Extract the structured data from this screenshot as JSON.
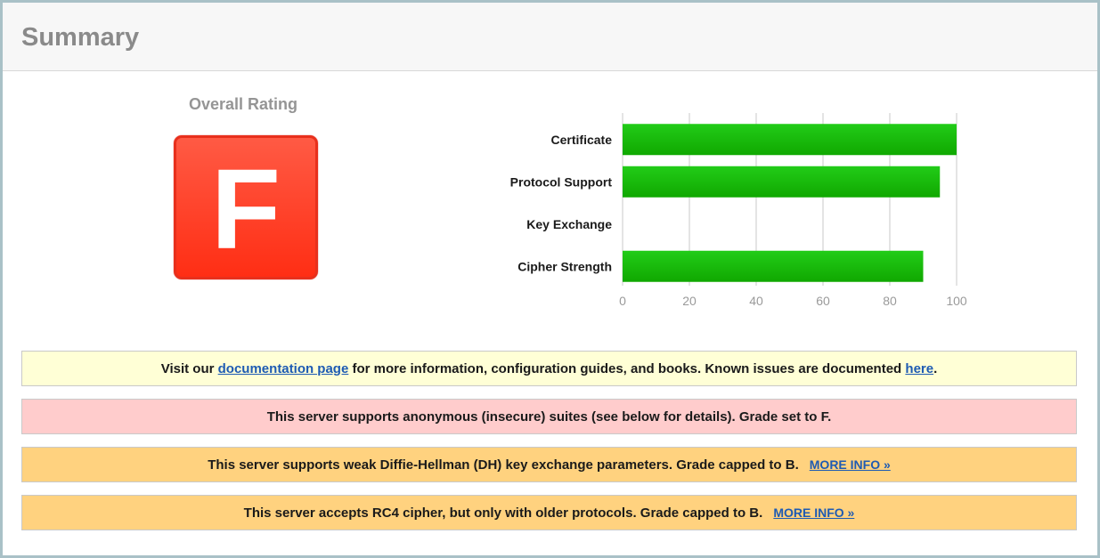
{
  "header": {
    "title": "Summary"
  },
  "rating": {
    "label": "Overall Rating",
    "grade": "F"
  },
  "chart_data": {
    "type": "bar",
    "orientation": "horizontal",
    "categories": [
      "Certificate",
      "Protocol Support",
      "Key Exchange",
      "Cipher Strength"
    ],
    "values": [
      100,
      95,
      0,
      90
    ],
    "xlim": [
      0,
      100
    ],
    "xticks": [
      0,
      20,
      40,
      60,
      80,
      100
    ],
    "grid": true,
    "bar_color": "#19b800"
  },
  "notices": {
    "docs": {
      "prefix": "Visit our ",
      "link1": "documentation page",
      "middle": " for more information, configuration guides, and books. Known issues are documented ",
      "link2": "here",
      "suffix": "."
    },
    "anon": {
      "text": "This server supports anonymous (insecure) suites (see below for details). Grade set to F."
    },
    "dh": {
      "text": "This server supports weak Diffie-Hellman (DH) key exchange parameters. Grade capped to B.",
      "link": "MORE INFO »"
    },
    "rc4": {
      "text": "This server accepts RC4 cipher, but only with older protocols. Grade capped to B.",
      "link": "MORE INFO »"
    }
  },
  "colors": {
    "grade": "#ff3b22",
    "notice_yellow": "#ffffd6",
    "notice_pink": "#ffcccc",
    "notice_orange": "#ffd27f",
    "link": "#1e5bb3"
  }
}
